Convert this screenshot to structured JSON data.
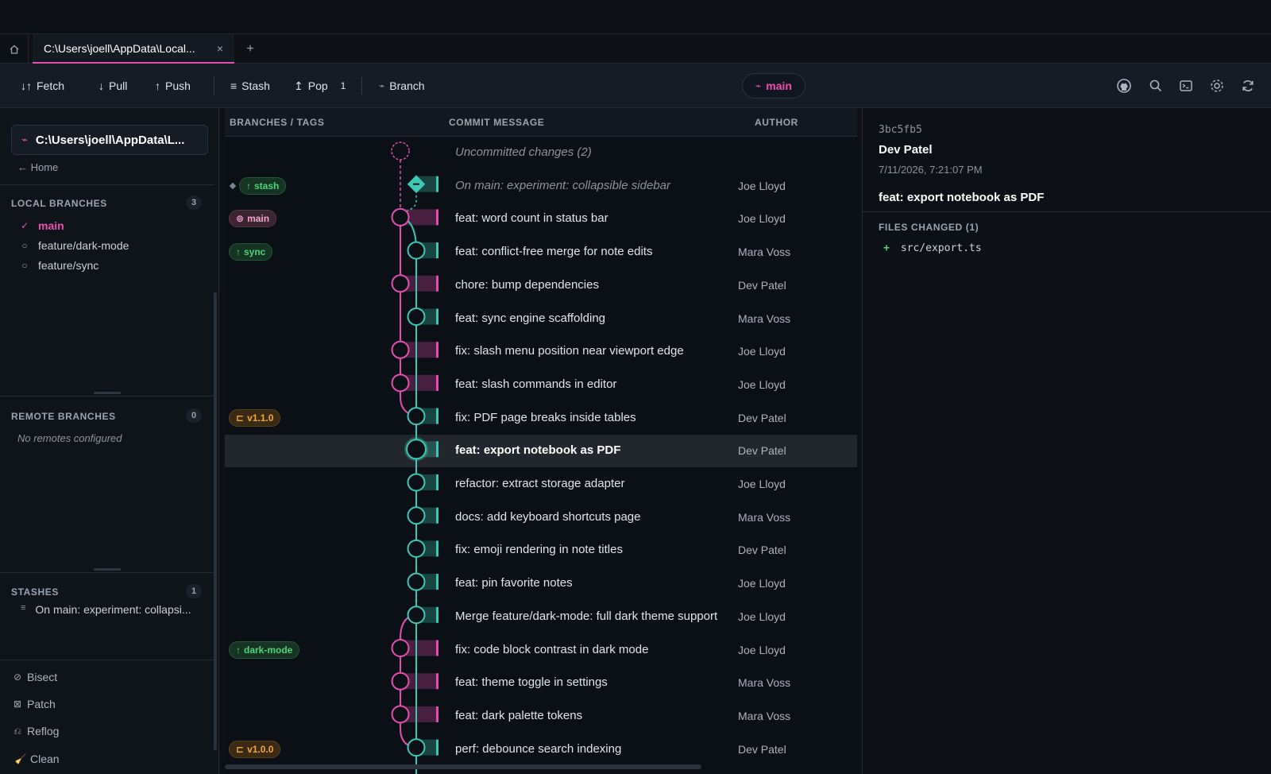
{
  "tabs": {
    "active_label": "C:\\Users\\joell\\AppData\\Local...",
    "close_glyph": "×",
    "add_glyph": "+"
  },
  "toolbar": {
    "fetch": "Fetch",
    "pull": "Pull",
    "push": "Push",
    "stash": "Stash",
    "pop": "Pop",
    "pop_count": "1",
    "branch": "Branch",
    "current_branch": "main"
  },
  "sidebar": {
    "repo_name": "C:\\Users\\joell\\AppData\\L...",
    "home_link": "← Home",
    "local_title": "LOCAL BRANCHES",
    "local_count": "3",
    "local_branches": [
      {
        "name": "main",
        "active": true
      },
      {
        "name": "feature/dark-mode",
        "active": false
      },
      {
        "name": "feature/sync",
        "active": false
      }
    ],
    "remote_title": "REMOTE BRANCHES",
    "remote_count": "0",
    "remote_empty": "No remotes configured",
    "stashes_title": "STASHES",
    "stashes_count": "1",
    "stashes": [
      "On main: experiment: collapsi..."
    ],
    "tools": [
      "Bisect",
      "Patch",
      "Reflog",
      "Clean"
    ]
  },
  "graph": {
    "headers": {
      "branches": "BRANCHES / TAGS",
      "message": "COMMIT MESSAGE",
      "author": "AUTHOR"
    },
    "colors": {
      "main": "#e64db3",
      "sync": "#3cc8b4"
    },
    "rows": [
      {
        "type": "uncommitted",
        "message": "Uncommitted changes (2)",
        "author": ""
      },
      {
        "type": "stash",
        "message": "On main: experiment: collapsible sidebar",
        "author": "Joe Lloyd",
        "tag": {
          "label": "stash",
          "style": "green",
          "icon": "↑"
        }
      },
      {
        "type": "main",
        "message": "feat: word count in status bar",
        "author": "Joe Lloyd",
        "tag": {
          "label": "main",
          "style": "pink",
          "icon": "⊚"
        }
      },
      {
        "type": "sync",
        "message": "feat: conflict-free merge for note edits",
        "author": "Mara Voss",
        "tag": {
          "label": "sync",
          "style": "green",
          "icon": "↑"
        }
      },
      {
        "type": "main",
        "message": "chore: bump dependencies",
        "author": "Dev Patel"
      },
      {
        "type": "sync",
        "message": "feat: sync engine scaffolding",
        "author": "Mara Voss"
      },
      {
        "type": "main",
        "message": "fix: slash menu position near viewport edge",
        "author": "Joe Lloyd"
      },
      {
        "type": "main",
        "message": "feat: slash commands in editor",
        "author": "Joe Lloyd"
      },
      {
        "type": "sync",
        "message": "fix: PDF page breaks inside tables",
        "author": "Dev Patel",
        "tag": {
          "label": "v1.1.0",
          "style": "orange",
          "icon": "⊏"
        }
      },
      {
        "type": "sync",
        "message": "feat: export notebook as PDF",
        "author": "Dev Patel",
        "selected": true
      },
      {
        "type": "sync",
        "message": "refactor: extract storage adapter",
        "author": "Joe Lloyd"
      },
      {
        "type": "sync",
        "message": "docs: add keyboard shortcuts page",
        "author": "Mara Voss"
      },
      {
        "type": "sync",
        "message": "fix: emoji rendering in note titles",
        "author": "Dev Patel"
      },
      {
        "type": "sync",
        "message": "feat: pin favorite notes",
        "author": "Joe Lloyd"
      },
      {
        "type": "sync",
        "message": "Merge feature/dark-mode: full dark theme support",
        "author": "Joe Lloyd"
      },
      {
        "type": "main",
        "message": "fix: code block contrast in dark mode",
        "author": "Joe Lloyd",
        "tag": {
          "label": "dark-mode",
          "style": "green",
          "icon": "↑"
        }
      },
      {
        "type": "main",
        "message": "feat: theme toggle in settings",
        "author": "Mara Voss"
      },
      {
        "type": "main",
        "message": "feat: dark palette tokens",
        "author": "Mara Voss"
      },
      {
        "type": "sync",
        "message": "perf: debounce search indexing",
        "author": "Dev Patel",
        "tag": {
          "label": "v1.0.0",
          "style": "orange",
          "icon": "⊏"
        }
      }
    ]
  },
  "details": {
    "hash": "3bc5fb5",
    "author": "Dev Patel",
    "date": "7/11/2026, 7:21:07 PM",
    "message": "feat: export notebook as PDF",
    "files_title": "FILES CHANGED (1)",
    "files": [
      {
        "status": "+",
        "path": "src/export.ts"
      }
    ]
  }
}
